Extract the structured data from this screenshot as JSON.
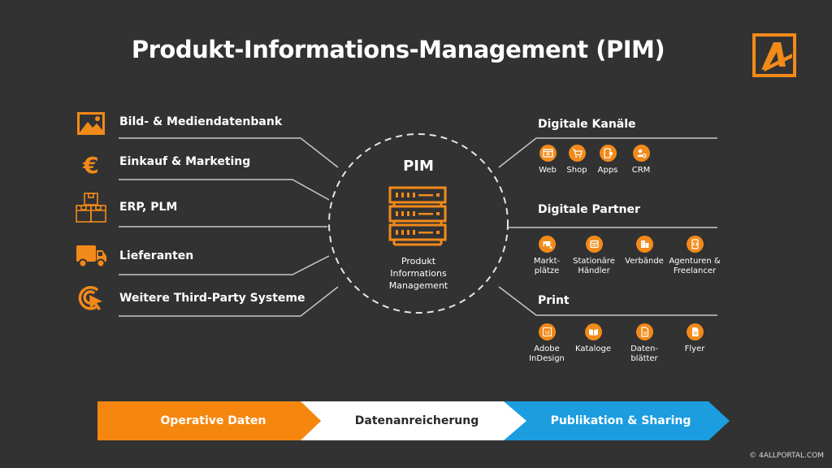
{
  "title": "Produkt-Informations-Management (PIM)",
  "colors": {
    "background": "#323232",
    "accent_orange": "#f28a1a",
    "accent_blue": "#1b9ddf",
    "line": "#c8c8c8"
  },
  "logo": {
    "icon": "4allportal-logo-icon"
  },
  "sources": [
    {
      "label": "Bild- & Mediendatenbank",
      "icon": "image-icon"
    },
    {
      "label": "Einkauf & Marketing",
      "icon": "euro-icon"
    },
    {
      "label": "ERP, PLM",
      "icon": "boxes-icon"
    },
    {
      "label": "Lieferanten",
      "icon": "truck-icon"
    },
    {
      "label": "Weitere Third-Party Systeme",
      "icon": "target-cursor-icon"
    }
  ],
  "pim": {
    "title": "PIM",
    "icon": "server-icon",
    "subtitle_lines": [
      "Produkt",
      "Informations",
      "Management"
    ]
  },
  "outputs": [
    {
      "heading": "Digitale Kanäle",
      "channels": [
        {
          "label": "Web",
          "icon": "browser-icon"
        },
        {
          "label": "Shop",
          "icon": "shopping-cart-icon"
        },
        {
          "label": "Apps",
          "icon": "mobile-app-icon"
        },
        {
          "label": "CRM",
          "icon": "user-gear-icon"
        }
      ]
    },
    {
      "heading": "Digitale Partner",
      "channels": [
        {
          "label": "Markt-\nplätze",
          "icon": "marketplace-icon"
        },
        {
          "label": "Stationäre\nHändler",
          "icon": "store-icon"
        },
        {
          "label": "Verbände",
          "icon": "buildings-icon"
        },
        {
          "label": "Agenturen &\nFreelancer",
          "icon": "device-code-icon"
        }
      ]
    },
    {
      "heading": "Print",
      "channels": [
        {
          "label": "Adobe\nInDesign",
          "icon": "indesign-icon"
        },
        {
          "label": "Kataloge",
          "icon": "open-book-icon"
        },
        {
          "label": "Daten-\nblätter",
          "icon": "datasheet-icon"
        },
        {
          "label": "Flyer",
          "icon": "flyer-icon"
        }
      ]
    }
  ],
  "process": [
    {
      "label": "Operative Daten",
      "color": "#f5870f"
    },
    {
      "label": "Datenanreicherung",
      "color": "#ffffff"
    },
    {
      "label": "Publikation & Sharing",
      "color": "#1b9ddf"
    }
  ],
  "copyright": "© 4ALLPORTAL.COM"
}
